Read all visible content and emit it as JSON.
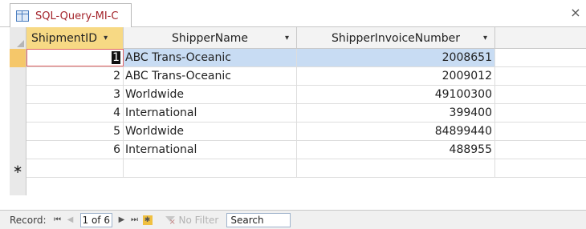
{
  "tab": {
    "title": "SQL-Query-MI-C",
    "close": "×"
  },
  "columns": [
    {
      "label": "ShipmentID",
      "sort_icon": "▾"
    },
    {
      "label": "ShipperName",
      "sort_icon": "▾"
    },
    {
      "label": "ShipperInvoiceNumber",
      "sort_icon": "▾"
    }
  ],
  "rows": [
    {
      "id": "1",
      "shipper": "ABC Trans-Oceanic",
      "invoice": "2008651"
    },
    {
      "id": "2",
      "shipper": "ABC Trans-Oceanic",
      "invoice": "2009012"
    },
    {
      "id": "3",
      "shipper": "Worldwide",
      "invoice": "49100300"
    },
    {
      "id": "4",
      "shipper": "International",
      "invoice": "399400"
    },
    {
      "id": "5",
      "shipper": "Worldwide",
      "invoice": "84899440"
    },
    {
      "id": "6",
      "shipper": "International",
      "invoice": "488955"
    }
  ],
  "new_row_marker": "∗",
  "navigation": {
    "record_label": "Record:",
    "current": "1 of 6",
    "filter_label": "No Filter",
    "search_label": "Search"
  },
  "colors": {
    "header_highlight": "#f7d984",
    "row_highlight": "#c8dcf3",
    "selector_highlight": "#f5c76a",
    "tab_text": "#a3232a"
  }
}
